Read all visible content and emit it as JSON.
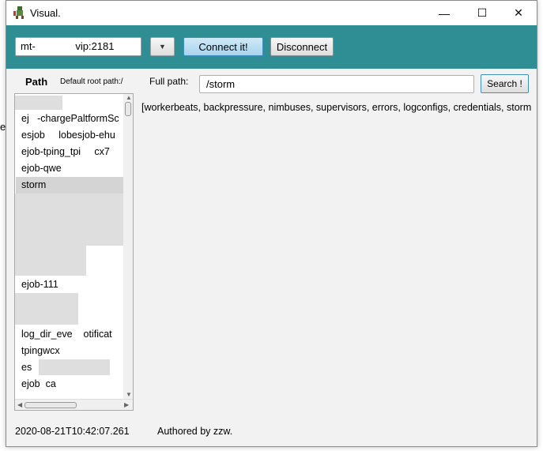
{
  "window": {
    "title": "Visual.",
    "minimize_glyph": "—",
    "maximize_glyph": "☐",
    "close_glyph": "✕"
  },
  "toolbar": {
    "connection_value": "mt-              vip:2181",
    "dropdown_glyph": "▼",
    "connect_label": "Connect it!",
    "disconnect_label": "Disconnect"
  },
  "left_panel": {
    "path_label": "Path",
    "root_label": "Default root path:/",
    "items": [
      {
        "label": "",
        "selected": false
      },
      {
        "label": "ej   -chargePaltformSc",
        "selected": false
      },
      {
        "label": "esjob     lobesjob-ehu",
        "selected": false
      },
      {
        "label": "ejob-tping_tpi     cx7",
        "selected": false
      },
      {
        "label": "ejob-qwe",
        "selected": false
      },
      {
        "label": "storm",
        "selected": true
      },
      {
        "label": "",
        "selected": false
      },
      {
        "label": "",
        "selected": false
      },
      {
        "label": "",
        "selected": false
      },
      {
        "label": "",
        "selected": false
      },
      {
        "label": "",
        "selected": false
      },
      {
        "label": "ejob-111",
        "selected": false
      },
      {
        "label": "",
        "selected": false
      },
      {
        "label": "",
        "selected": false
      },
      {
        "label": "log_dir_eve    otificat",
        "selected": false
      },
      {
        "label": "tpingwcx",
        "selected": false
      },
      {
        "label": "es",
        "selected": false
      },
      {
        "label": "ejob  ca",
        "selected": false
      }
    ]
  },
  "main": {
    "fullpath_label": "Full path:",
    "fullpath_value": "/storm",
    "search_label": "Search !",
    "result": "[workerbeats, backpressure, nimbuses, supervisors, errors, logconfigs, credentials, storm"
  },
  "status": {
    "timestamp": "2020-08-21T10:42:07.261",
    "author": "Authored by zzw."
  },
  "edge_fragment": "e",
  "colors": {
    "toolbar_bg": "#2f8e93",
    "connect_bg": "#b7dcf0",
    "selected_row": "#d4d4d4"
  }
}
